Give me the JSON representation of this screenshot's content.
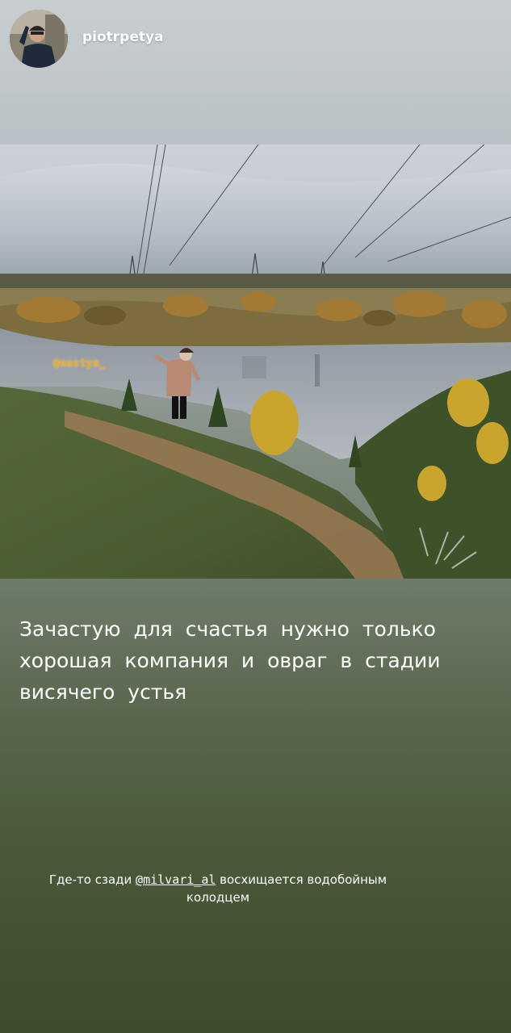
{
  "header": {
    "username": "piotrpetya"
  },
  "photo": {
    "mention_sticker": "@nastya_"
  },
  "caption": {
    "lines": [
      "Зачастую для счастья нужно только",
      "хорошая компания и овраг в стадии",
      "висячего устья"
    ]
  },
  "footnote": {
    "prefix": "Где-то сзади ",
    "handle": "@milvari_al",
    "suffix": " восхищается водобойным",
    "line2": "колодцем"
  },
  "colors": {
    "sticker_orange": "#f0a81f",
    "text": "#ffffff"
  }
}
